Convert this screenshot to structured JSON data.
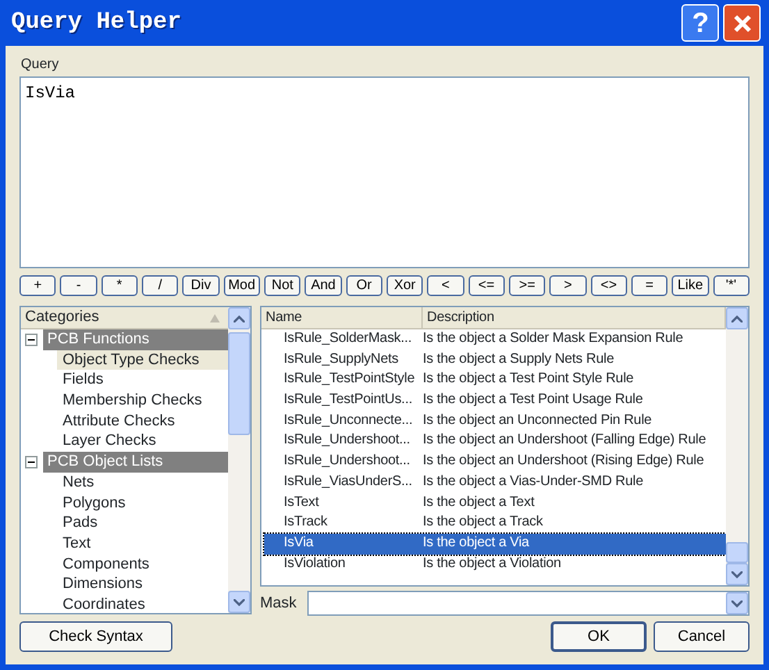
{
  "window": {
    "title": "Query Helper",
    "help_button": "?"
  },
  "query": {
    "label": "Query",
    "value": "IsVia"
  },
  "operators": [
    "+",
    "-",
    "*",
    "/",
    "Div",
    "Mod",
    "Not",
    "And",
    "Or",
    "Xor",
    "<",
    "<=",
    ">=",
    ">",
    "<>",
    "=",
    "Like",
    "'*'"
  ],
  "categories": {
    "header": "Categories",
    "groups": [
      {
        "label": "PCB Functions",
        "expanded": true,
        "children": [
          {
            "label": "Object Type Checks",
            "selected": true
          },
          {
            "label": "Fields",
            "selected": false
          },
          {
            "label": "Membership Checks",
            "selected": false
          },
          {
            "label": "Attribute Checks",
            "selected": false
          },
          {
            "label": "Layer Checks",
            "selected": false
          }
        ]
      },
      {
        "label": "PCB Object Lists",
        "expanded": true,
        "children": [
          {
            "label": "Nets",
            "selected": false
          },
          {
            "label": "Polygons",
            "selected": false
          },
          {
            "label": "Pads",
            "selected": false
          },
          {
            "label": "Text",
            "selected": false
          },
          {
            "label": "Components",
            "selected": false
          },
          {
            "label": "Dimensions",
            "selected": false
          },
          {
            "label": "Coordinates",
            "selected": false
          }
        ]
      }
    ]
  },
  "table": {
    "columns": [
      "Name",
      "Description"
    ],
    "rows": [
      {
        "name": "IsRule_SolderMask...",
        "description": "Is the object a Solder Mask Expansion Rule",
        "selected": false
      },
      {
        "name": "IsRule_SupplyNets",
        "description": "Is the object a Supply Nets Rule",
        "selected": false
      },
      {
        "name": "IsRule_TestPointStyle",
        "description": "Is the object a Test Point Style Rule",
        "selected": false
      },
      {
        "name": "IsRule_TestPointUs...",
        "description": "Is the object a Test Point Usage Rule",
        "selected": false
      },
      {
        "name": "IsRule_Unconnecte...",
        "description": "Is the object an Unconnected Pin Rule",
        "selected": false
      },
      {
        "name": "IsRule_Undershoot...",
        "description": "Is the object an Undershoot (Falling Edge) Rule",
        "selected": false
      },
      {
        "name": "IsRule_Undershoot...",
        "description": "Is the object an Undershoot (Rising Edge) Rule",
        "selected": false
      },
      {
        "name": "IsRule_ViasUnderS...",
        "description": "Is the object a Vias-Under-SMD Rule",
        "selected": false
      },
      {
        "name": "IsText",
        "description": "Is the object a Text",
        "selected": false
      },
      {
        "name": "IsTrack",
        "description": "Is the object a Track",
        "selected": false
      },
      {
        "name": "IsVia",
        "description": "Is the object a Via",
        "selected": true
      },
      {
        "name": "IsViolation",
        "description": "Is the object a Violation",
        "selected": false
      }
    ]
  },
  "mask": {
    "label": "Mask"
  },
  "buttons": {
    "check_syntax": "Check Syntax",
    "ok": "OK",
    "cancel": "Cancel"
  }
}
